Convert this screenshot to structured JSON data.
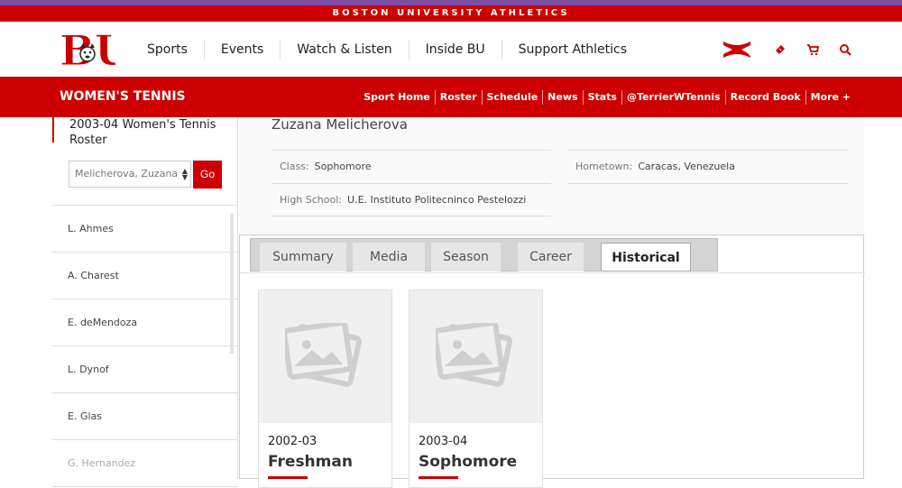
{
  "top_strip": {
    "text": "BOSTON UNIVERSITY ATHLETICS"
  },
  "colors": {
    "brand_red": "#cc0000",
    "purple_accent": "#7b4ea3"
  },
  "logo": {
    "text": "BU"
  },
  "nav": {
    "items": [
      "Sports",
      "Events",
      "Watch & Listen",
      "Inside BU",
      "Support Athletics"
    ],
    "icons": [
      "under-armour-logo",
      "ticket-icon",
      "cart-icon",
      "search-icon"
    ]
  },
  "sport_bar": {
    "title": "WOMEN'S TENNIS",
    "links": [
      "Sport Home",
      "Roster",
      "Schedule",
      "News",
      "Stats",
      "@TerrierWTennis",
      "Record Book",
      "More +"
    ]
  },
  "sidebar": {
    "roster_title": "2003-04 Women's Tennis Roster",
    "select_value": "Melicherova, Zuzana",
    "go_label": "Go",
    "players": [
      "L. Ahmes",
      "A. Charest",
      "E. deMendoza",
      "L. Dynof",
      "E. Glas",
      "G. Hernandez"
    ]
  },
  "player": {
    "name": "Zuzana Melicherova",
    "class_label": "Class:",
    "class_value": "Sophomore",
    "hometown_label": "Hometown:",
    "hometown_value": "Caracas, Venezuela",
    "high_school_label": "High School:",
    "high_school_value": "U.E. Instituto Politecninco Pestelozzi"
  },
  "tabs": {
    "items": [
      "Summary",
      "Media",
      "Season",
      "Career",
      "Historical"
    ],
    "active": "Historical"
  },
  "cards": [
    {
      "season": "2002-03",
      "class": "Freshman"
    },
    {
      "season": "2003-04",
      "class": "Sophomore"
    }
  ]
}
